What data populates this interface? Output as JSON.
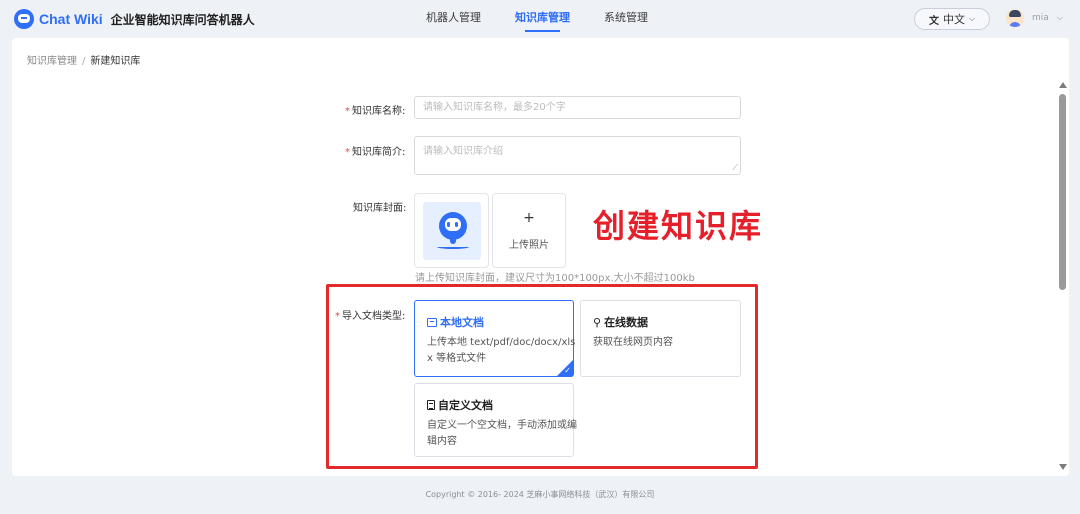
{
  "brand": {
    "name": "Chat Wiki",
    "subtitle": "企业智能知识库问答机器人"
  },
  "nav": {
    "items": [
      {
        "label": "机器人管理",
        "active": false
      },
      {
        "label": "知识库管理",
        "active": true
      },
      {
        "label": "系统管理",
        "active": false
      }
    ]
  },
  "language": {
    "label": "中文"
  },
  "user": {
    "name": "mia"
  },
  "breadcrumb": {
    "parent": "知识库管理",
    "separator": "/",
    "current": "新建知识库"
  },
  "form": {
    "name": {
      "label": "知识库名称:",
      "placeholder": "请输入知识库名称，最多20个字"
    },
    "intro": {
      "label": "知识库简介:",
      "placeholder": "请输入知识库介绍"
    },
    "cover": {
      "label": "知识库封面:",
      "upload_plus": "+",
      "upload_label": "上传照片",
      "hint": "请上传知识库封面，建议尺寸为100*100px.大小不超过100kb"
    },
    "doc_type": {
      "label": "导入文档类型:",
      "options": [
        {
          "title": "本地文档",
          "desc": "上传本地 text/pdf/doc/docx/xlsx 等格式文件",
          "selected": true,
          "icon": "folder-icon"
        },
        {
          "title": "在线数据",
          "desc": "获取在线网页内容",
          "selected": false,
          "icon": "link-icon"
        },
        {
          "title": "自定义文档",
          "desc": "自定义一个空文档，手动添加或编辑内容",
          "selected": false,
          "icon": "document-icon"
        }
      ]
    }
  },
  "annotation": {
    "text": "创建知识库",
    "color": "#e5202a"
  },
  "colors": {
    "accent": "#2f6ef6",
    "required": "#e5484d",
    "frame": "#e32a2a"
  },
  "footer": {
    "copyright": "Copyright © 2016- 2024 芝麻小事网络科技（武汉）有限公司"
  }
}
